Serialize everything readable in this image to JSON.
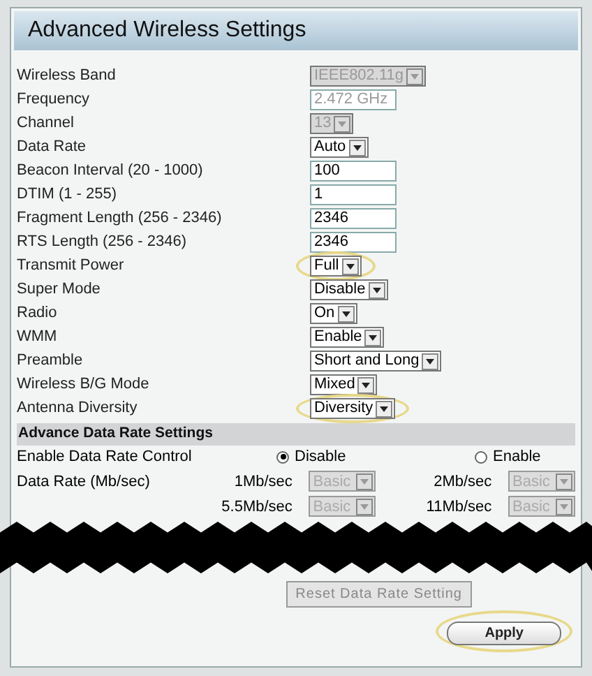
{
  "title": "Advanced Wireless Settings",
  "fields": [
    {
      "label": "Wireless Band",
      "kind": "select",
      "value": "IEEE802.11g",
      "disabled": true,
      "highlighted": false
    },
    {
      "label": "Frequency",
      "kind": "text",
      "value": "2.472 GHz",
      "disabled": true,
      "highlighted": false
    },
    {
      "label": "Channel",
      "kind": "select",
      "value": "13",
      "disabled": true,
      "highlighted": false
    },
    {
      "label": "Data Rate",
      "kind": "select",
      "value": "Auto",
      "disabled": false,
      "highlighted": false
    },
    {
      "label": "Beacon Interval (20 - 1000)",
      "kind": "text",
      "value": "100",
      "disabled": false,
      "highlighted": false
    },
    {
      "label": "DTIM (1 - 255)",
      "kind": "text",
      "value": "1",
      "disabled": false,
      "highlighted": false
    },
    {
      "label": "Fragment Length (256 - 2346)",
      "kind": "text",
      "value": "2346",
      "disabled": false,
      "highlighted": false
    },
    {
      "label": "RTS Length (256 - 2346)",
      "kind": "text",
      "value": "2346",
      "disabled": false,
      "highlighted": false
    },
    {
      "label": "Transmit Power",
      "kind": "select",
      "value": "Full",
      "disabled": false,
      "highlighted": true
    },
    {
      "label": "Super Mode",
      "kind": "select",
      "value": "Disable",
      "disabled": false,
      "highlighted": false
    },
    {
      "label": "Radio",
      "kind": "select",
      "value": "On",
      "disabled": false,
      "highlighted": false
    },
    {
      "label": "WMM",
      "kind": "select",
      "value": "Enable",
      "disabled": false,
      "highlighted": false
    },
    {
      "label": "Preamble",
      "kind": "select",
      "value": "Short and Long",
      "disabled": false,
      "highlighted": false
    },
    {
      "label": "Wireless B/G Mode",
      "kind": "select",
      "value": "Mixed",
      "disabled": false,
      "highlighted": false
    },
    {
      "label": "Antenna Diversity",
      "kind": "select",
      "value": "Diversity",
      "disabled": false,
      "highlighted": true
    }
  ],
  "section": {
    "title": "Advance Data Rate Settings",
    "control_label": "Enable Data Rate Control",
    "options": [
      {
        "label": "Disable",
        "selected": true
      },
      {
        "label": "Enable",
        "selected": false
      }
    ],
    "rate_label": "Data Rate (Mb/sec)",
    "rates": [
      {
        "label_1": "1Mb/sec",
        "value_1": "Basic",
        "label_2": "2Mb/sec",
        "value_2": "Basic"
      },
      {
        "label_1": "5.5Mb/sec",
        "value_1": "Basic",
        "label_2": "11Mb/sec",
        "value_2": "Basic"
      }
    ],
    "reset_button": "Reset Data Rate Setting"
  },
  "apply_button": {
    "label": "Apply",
    "highlighted": true
  }
}
